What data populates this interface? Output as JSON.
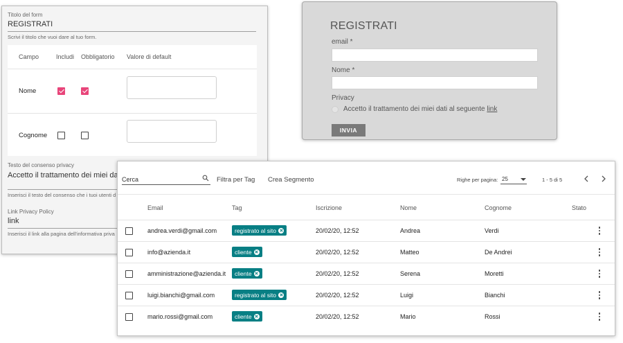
{
  "form_builder": {
    "title_label": "Titolo del form",
    "title_value": "REGISTRATI",
    "title_help": "Scrivi il titolo che vuoi dare al tuo form.",
    "columns": [
      "Campo",
      "Includi",
      "Obbligatorio",
      "Valore di default"
    ],
    "fields": [
      {
        "name": "Nome",
        "include": true,
        "required": true,
        "default": ""
      },
      {
        "name": "Cognome",
        "include": false,
        "required": false,
        "default": ""
      }
    ],
    "consent_label": "Testo del consenso privacy",
    "consent_value": "Accetto il trattamento dei miei dati",
    "consent_help": "Inserisci il testo del consenso che i tuoi utenti d",
    "privacy_link_label": "Link Privacy Policy",
    "privacy_link_value": "link",
    "privacy_link_help": "Inserisci il link alla pagina dell'informativa priva",
    "accent_color": "#e8457a"
  },
  "preview": {
    "title": "REGISTRATI",
    "email_label": "email *",
    "name_label": "Nome *",
    "privacy_label": "Privacy",
    "consent_text": "Accetto il trattamento dei miei dati al seguente",
    "consent_link": "link",
    "submit_label": "INVIA"
  },
  "contacts": {
    "search_placeholder": "Cerca",
    "filter_label": "Filtra per Tag",
    "segment_label": "Crea Segmento",
    "rows_per_page_label": "Righe per pagina:",
    "rows_per_page_value": "25",
    "range_text": "1 - 5 di 5",
    "headers": [
      "Email",
      "Tag",
      "Iscrizione",
      "Nome",
      "Cognome",
      "Stato"
    ],
    "tag_color": "#087f84",
    "rows": [
      {
        "email": "andrea.verdi@gmail.com",
        "tag": "registrato al sito",
        "date": "20/02/20, 12:52",
        "first": "Andrea",
        "last": "Verdi"
      },
      {
        "email": "info@azienda.it",
        "tag": "cliente",
        "date": "20/02/20, 12:52",
        "first": "Matteo",
        "last": "De Andrei"
      },
      {
        "email": "amministrazione@azienda.it",
        "tag": "cliente",
        "date": "20/02/20, 12:52",
        "first": "Serena",
        "last": "Moretti"
      },
      {
        "email": "luigi.bianchi@gmail.com",
        "tag": "registrato al sito",
        "date": "20/02/20, 12:52",
        "first": "Luigi",
        "last": "Bianchi"
      },
      {
        "email": "mario.rossi@gmail.com",
        "tag": "cliente",
        "date": "20/02/20, 12:52",
        "first": "Mario",
        "last": "Rossi"
      }
    ]
  }
}
